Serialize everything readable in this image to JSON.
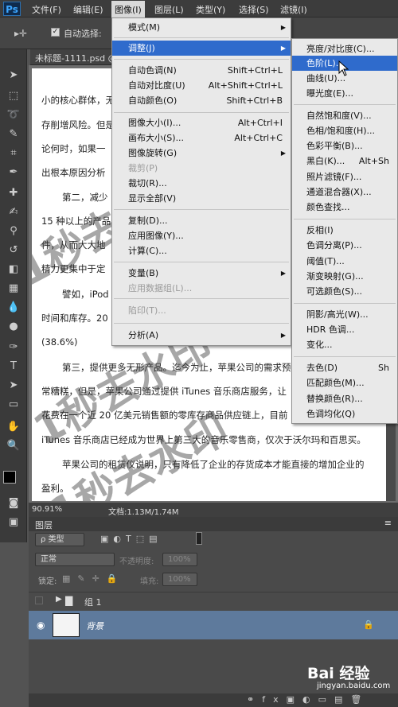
{
  "app": {
    "logo": "Ps"
  },
  "menubar": [
    {
      "label": "文件(F)"
    },
    {
      "label": "编辑(E)"
    },
    {
      "label": "图像(I)"
    },
    {
      "label": "图层(L)"
    },
    {
      "label": "类型(Y)"
    },
    {
      "label": "选择(S)"
    },
    {
      "label": "滤镜(I)"
    }
  ],
  "options": {
    "auto_select": "自动选择:"
  },
  "document": {
    "tab": "未标题-1111.psd @"
  },
  "paper_lines": [
    "小的核心群体，无",
    "存削增风险。但是",
    "论何时，如果一",
    "出根本原因分析",
    "第二，减少",
    "15 种以上的产品",
    "件，从而大大地",
    "精力更集中于定",
    "譬如，iPod",
    "时间和库存。20",
    "(38.6%)",
    "第三，提供更多无形产品。迄今为止，苹果公司的需求预",
    "常糟糕，但是，苹果公司通过提供 iTunes 音乐商店服务，让",
    "花费在一个近 20 亿美元销售额的零库存商品供应链上，目前",
    "iTunes 音乐商店已经成为世界上第三大的音乐零售商，仅次于沃尔玛和百思买。",
    "苹果公司的租赁仪说明，只有降低了企业的存货成本才能直接的增加企业的",
    "盈利。"
  ],
  "watermark": "1秒去水印",
  "status": {
    "zoom": "90.91%",
    "doc": "文档:1.13M/1.74M"
  },
  "layers": {
    "tab": "图层",
    "kind": "ρ 类型",
    "blend": "正常",
    "opacity_label": "不透明度:",
    "opacity_value": "100%",
    "lock_label": "锁定:",
    "fill_label": "填充:",
    "fill_value": "100%",
    "group_name": "组 1",
    "bg_name": "背景"
  },
  "image_menu": {
    "items": [
      {
        "label": "模式(M)",
        "shortcut": "",
        "submenu": true
      },
      {
        "label": "调整(J)",
        "shortcut": "",
        "submenu": true,
        "highlighted": true
      },
      {
        "label": "自动色调(N)",
        "shortcut": "Shift+Ctrl+L"
      },
      {
        "label": "自动对比度(U)",
        "shortcut": "Alt+Shift+Ctrl+L"
      },
      {
        "label": "自动颜色(O)",
        "shortcut": "Shift+Ctrl+B"
      },
      {
        "label": "图像大小(I)...",
        "shortcut": "Alt+Ctrl+I"
      },
      {
        "label": "画布大小(S)...",
        "shortcut": "Alt+Ctrl+C"
      },
      {
        "label": "图像旋转(G)",
        "shortcut": "",
        "submenu": true
      },
      {
        "label": "裁剪(P)",
        "shortcut": "",
        "disabled": true
      },
      {
        "label": "裁切(R)...",
        "shortcut": ""
      },
      {
        "label": "显示全部(V)",
        "shortcut": ""
      },
      {
        "label": "复制(D)...",
        "shortcut": ""
      },
      {
        "label": "应用图像(Y)...",
        "shortcut": ""
      },
      {
        "label": "计算(C)...",
        "shortcut": ""
      },
      {
        "label": "变量(B)",
        "shortcut": "",
        "submenu": true
      },
      {
        "label": "应用数据组(L)...",
        "shortcut": "",
        "disabled": true
      },
      {
        "label": "陷印(T)...",
        "shortcut": "",
        "disabled": true
      },
      {
        "label": "分析(A)",
        "shortcut": "",
        "submenu": true
      }
    ]
  },
  "adjust_menu": {
    "items": [
      {
        "label": "亮度/对比度(C)...",
        "shortcut": ""
      },
      {
        "label": "色阶(L)...",
        "shortcut": "",
        "highlighted": true
      },
      {
        "label": "曲线(U)...",
        "shortcut": ""
      },
      {
        "label": "曝光度(E)...",
        "shortcut": ""
      },
      {
        "label": "自然饱和度(V)...",
        "shortcut": ""
      },
      {
        "label": "色相/饱和度(H)...",
        "shortcut": ""
      },
      {
        "label": "色彩平衡(B)...",
        "shortcut": ""
      },
      {
        "label": "黑白(K)...",
        "shortcut": "Alt+Sh"
      },
      {
        "label": "照片滤镜(F)...",
        "shortcut": ""
      },
      {
        "label": "通道混合器(X)...",
        "shortcut": ""
      },
      {
        "label": "颜色查找...",
        "shortcut": ""
      },
      {
        "label": "反相(I)",
        "shortcut": ""
      },
      {
        "label": "色调分离(P)...",
        "shortcut": ""
      },
      {
        "label": "阈值(T)...",
        "shortcut": ""
      },
      {
        "label": "渐变映射(G)...",
        "shortcut": ""
      },
      {
        "label": "可选颜色(S)...",
        "shortcut": ""
      },
      {
        "label": "阴影/高光(W)...",
        "shortcut": ""
      },
      {
        "label": "HDR 色调...",
        "shortcut": ""
      },
      {
        "label": "变化...",
        "shortcut": ""
      },
      {
        "label": "去色(D)",
        "shortcut": "Sh"
      },
      {
        "label": "匹配颜色(M)...",
        "shortcut": ""
      },
      {
        "label": "替换颜色(R)...",
        "shortcut": ""
      },
      {
        "label": "色调均化(Q)",
        "shortcut": ""
      }
    ]
  },
  "baidu": {
    "logo": "Bai 经验",
    "url": "jingyan.baidu.com"
  }
}
